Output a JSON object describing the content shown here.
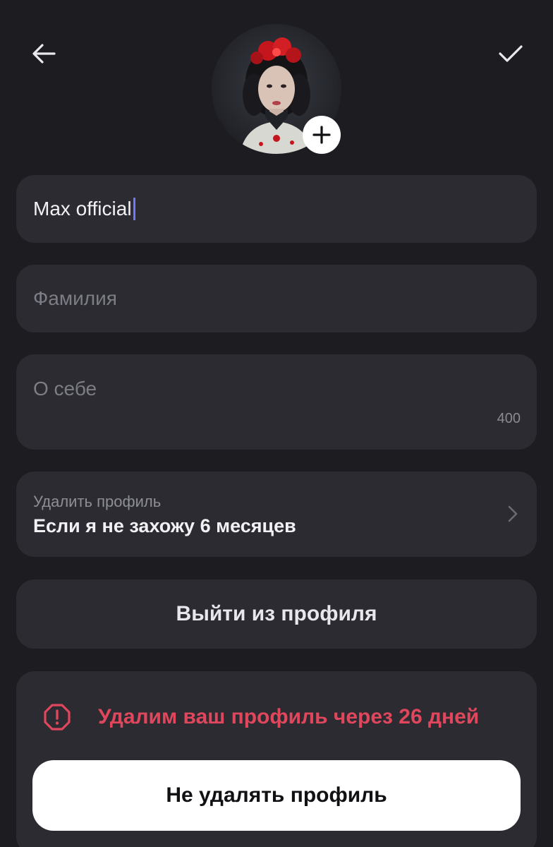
{
  "header": {
    "back_icon": "arrow-left-icon",
    "confirm_icon": "checkmark-icon",
    "avatar": {
      "description_icon": "profile-avatar-portrait",
      "add_icon": "plus-icon"
    }
  },
  "form": {
    "first_name": {
      "value": "Max official"
    },
    "last_name": {
      "value": "",
      "placeholder": "Фамилия"
    },
    "about": {
      "value": "",
      "placeholder": "О себе",
      "counter": "400"
    }
  },
  "delete_profile": {
    "caption": "Удалить профиль",
    "value": "Если я не захожу 6 месяцев",
    "icon": "chevron-right-icon"
  },
  "logout": {
    "label": "Выйти из профиля"
  },
  "warning": {
    "icon": "alert-circle-icon",
    "text": "Удалим ваш профиль через 26 дней",
    "keep_button": "Не удалять профиль"
  },
  "colors": {
    "background": "#1d1d21",
    "card": "#2b2b31",
    "accent_caret": "#6f76ff",
    "danger": "#e0475c",
    "button_light": "#ffffff"
  }
}
